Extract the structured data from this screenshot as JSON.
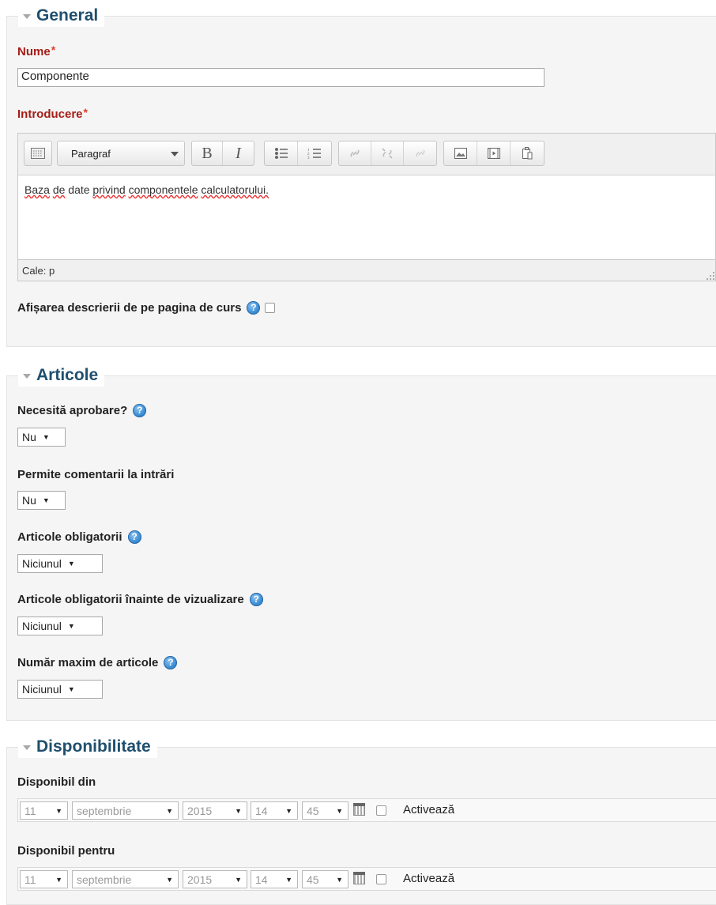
{
  "general": {
    "title": "General",
    "name_label": "Nume",
    "required_mark": "*",
    "name_value": "Componente",
    "intro_label": "Introducere",
    "toolbar": {
      "paragraph_select": "Paragraf",
      "bold": "B",
      "italic": "I",
      "icons": [
        "toolbar-toggle-icon",
        "unordered-list-icon",
        "ordered-list-icon",
        "link-icon",
        "unlink-icon",
        "anchor-icon",
        "image-icon",
        "media-icon",
        "paste-icon"
      ]
    },
    "editor_text_words": [
      "Baza",
      "de",
      "date",
      "privind",
      "componentele",
      "calculatorului."
    ],
    "editor_path": "Cale: p",
    "show_desc_label": "Afișarea descrierii de pe pagina de curs"
  },
  "articles": {
    "title": "Articole",
    "approval_label": "Necesită aprobare?",
    "approval_value": "Nu",
    "comments_label": "Permite comentarii la intrări",
    "comments_value": "Nu",
    "required_entries_label": "Articole obligatorii",
    "required_entries_value": "Niciunul",
    "required_view_label": "Articole obligatorii înainte de vizualizare",
    "required_view_value": "Niciunul",
    "max_entries_label": "Număr maxim de articole",
    "max_entries_value": "Niciunul"
  },
  "availability": {
    "title": "Disponibilitate",
    "from_label": "Disponibil din",
    "to_label": "Disponibil pentru",
    "from": {
      "day": "11",
      "month": "septembrie",
      "year": "2015",
      "hour": "14",
      "minute": "45",
      "enable": "Activează"
    },
    "to": {
      "day": "11",
      "month": "septembrie",
      "year": "2015",
      "hour": "14",
      "minute": "45",
      "enable": "Activează"
    }
  },
  "help_icon": "?",
  "dropdown_arrow": "▼",
  "colors": {
    "legend": "#1f4f6e",
    "required": "#a41d16",
    "help": "#3d8fd6"
  }
}
